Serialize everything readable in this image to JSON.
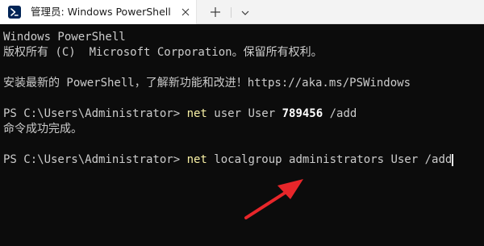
{
  "tab": {
    "title": "管理员: Windows PowerShell",
    "icon": "powershell-icon",
    "close_icon": "close-icon"
  },
  "toolbar": {
    "new_tab_icon": "plus-icon",
    "dropdown_icon": "chevron-down-icon"
  },
  "console": {
    "line1": "Windows PowerShell",
    "line2": "版权所有 (C)  Microsoft Corporation。保留所有权利。",
    "line3": "安装最新的 PowerShell，了解新功能和改进！https://aka.ms/PSWindows",
    "prompt1": "PS C:\\Users\\Administrator> ",
    "cmd1_keyword": "net",
    "cmd1_rest_a": " user User ",
    "cmd1_number": "789456",
    "cmd1_rest_b": " /add",
    "output1": "命令成功完成。",
    "prompt2": "PS C:\\Users\\Administrator> ",
    "cmd2_keyword": "net",
    "cmd2_rest": " localgroup administrators User /add"
  },
  "colors": {
    "console_bg": "#0c0c0c",
    "console_fg": "#cccccc",
    "command_keyword": "#f9f1a5",
    "annotation_arrow": "#e8262a"
  }
}
